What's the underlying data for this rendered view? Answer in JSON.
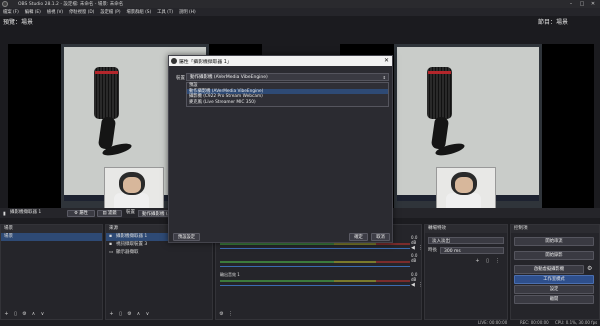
{
  "window": {
    "title": "OBS Studio 28.1.2 - 設定檔: 未命名 - 場景: 未命名"
  },
  "menu": [
    "檔案 (F)",
    "編輯 (E)",
    "檢視 (V)",
    "停駐視窗 (D)",
    "設定檔 (P)",
    "場景群組 (S)",
    "工具 (T)",
    "說明 (H)"
  ],
  "preview": {
    "left_label": "預覽：場景",
    "right_label": "節目：場景"
  },
  "dialog": {
    "title": "屬性「攝影機擷取器 1」",
    "device_label": "裝置",
    "device_value": "動作攝影機 (AVerMedia VibeEngine)",
    "options": [
      "預設",
      "動作攝影機 (AVerMedia VibeEngine)",
      "攝影機 (C922 Pro Stream Webcam)",
      "麥克風 (Live Streamer MIC 350)"
    ],
    "selected_index": 1,
    "defaults_button": "預設設定",
    "ok_button": "確定",
    "cancel_button": "取消"
  },
  "toolbar": {
    "source_name": "攝影機擷取器 1",
    "properties_button": "屬性",
    "filters_button": "濾鏡",
    "device_label": "裝置",
    "device_value": "動作攝影機 (AVerMedia VibeEngine)"
  },
  "scenes": {
    "header": "場景",
    "items": [
      "場景"
    ]
  },
  "sources": {
    "header": "來源",
    "items": [
      "攝影機擷取器 1",
      "視訊擷取裝置 3",
      "顯示器擷取"
    ]
  },
  "mixer": {
    "channels": [
      {
        "level": "0.0 dB"
      },
      {
        "level": "0.0 dB"
      },
      {
        "name": "輸出音效 1",
        "level": "0.0 dB"
      }
    ]
  },
  "transitions": {
    "header": "轉場特效",
    "type": "淡入淡出",
    "duration_label": "時長",
    "duration_value": "300 ms"
  },
  "controls": {
    "header": "控制項",
    "buttons": [
      "開始串流",
      "開始錄影",
      "啟動虛擬攝影機",
      "工作室模式",
      "設定",
      "離開"
    ],
    "active_index": 3
  },
  "status": {
    "live": "LIVE: 00:00:00",
    "rec": "REC: 00:00:00",
    "cpu": "CPU: 0.1%, 30.00 fps"
  }
}
